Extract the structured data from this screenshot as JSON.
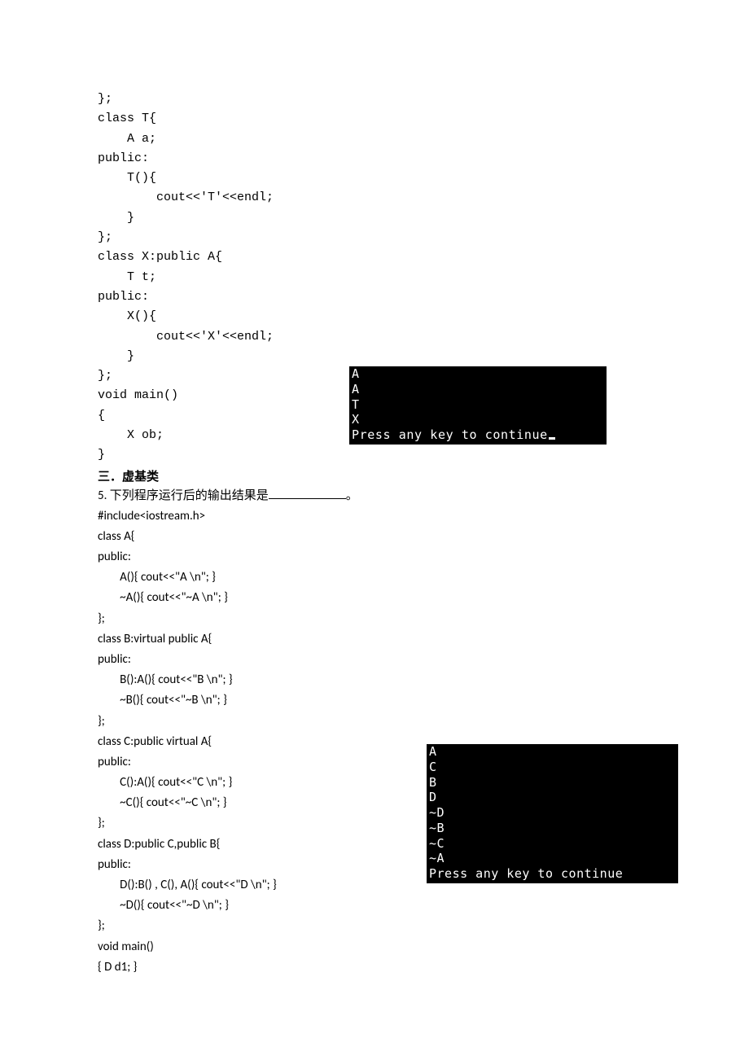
{
  "code1": "};\nclass T{\n    A a;\npublic:\n    T(){\n        cout<<'T'<<endl;\n    }\n};\nclass X:public A{\n    T t;\npublic:\n    X(){\n        cout<<'X'<<endl;\n    }\n};\nvoid main()\n{\n    X ob;\n}",
  "section_title": "三．虚基类",
  "question5_prefix": "5.  下列程序运行后的输出结果是",
  "question5_suffix": "。",
  "code2": [
    {
      "indent": 0,
      "text": "#include<iostream.h>"
    },
    {
      "indent": 0,
      "text": "class A{"
    },
    {
      "indent": 0,
      "text": "public:"
    },
    {
      "indent": 1,
      "text": "A(){ cout<<\"A \\n\"; }"
    },
    {
      "indent": 1,
      "text": "~A(){ cout<<\"~A \\n\"; }"
    },
    {
      "indent": 0,
      "text": "};"
    },
    {
      "indent": 0,
      "text": "class B:virtual public A{"
    },
    {
      "indent": 0,
      "text": "public:"
    },
    {
      "indent": 1,
      "text": "B():A(){ cout<<\"B \\n\"; }"
    },
    {
      "indent": 1,
      "text": "~B(){ cout<<\"~B \\n\"; }"
    },
    {
      "indent": 0,
      "text": "};"
    },
    {
      "indent": 0,
      "text": "class C:public virtual A{"
    },
    {
      "indent": 0,
      "text": "public:"
    },
    {
      "indent": 1,
      "text": "C():A(){ cout<<\"C \\n\"; }"
    },
    {
      "indent": 1,
      "text": "~C(){ cout<<\"~C \\n\"; }"
    },
    {
      "indent": 0,
      "text": "};"
    },
    {
      "indent": 0,
      "text": "class D:public C,public B{"
    },
    {
      "indent": 0,
      "text": "public:"
    },
    {
      "indent": 1,
      "text": "D():B() , C(), A(){ cout<<\"D \\n\"; }"
    },
    {
      "indent": 1,
      "text": "~D(){ cout<<\"~D \\n\"; }"
    },
    {
      "indent": 0,
      "text": "};"
    },
    {
      "indent": 0,
      "text": "void main()"
    },
    {
      "indent": 0,
      "text": "{ D d1; }"
    }
  ],
  "terminal1": "A\nA\nT\nX\nPress any key to continue",
  "terminal2": "A\nC\nB\nD\n~D\n~B\n~C\n~A\nPress any key to continue"
}
